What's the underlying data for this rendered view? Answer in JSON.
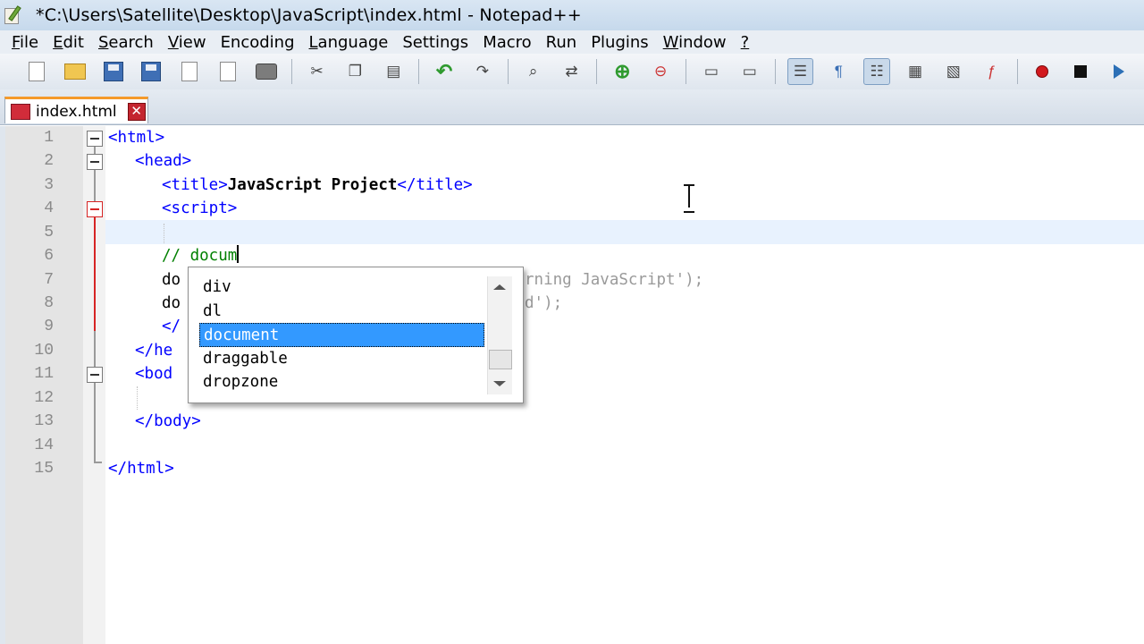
{
  "window": {
    "title": "*C:\\Users\\Satellite\\Desktop\\JavaScript\\index.html - Notepad++"
  },
  "menu": [
    {
      "ul": "F",
      "rest": "ile"
    },
    {
      "ul": "E",
      "rest": "dit"
    },
    {
      "ul": "S",
      "rest": "earch"
    },
    {
      "ul": "V",
      "rest": "iew"
    },
    {
      "ul": "",
      "rest": "Encoding"
    },
    {
      "ul": "L",
      "rest": "anguage"
    },
    {
      "ul": "",
      "rest": "Settings"
    },
    {
      "ul": "",
      "rest": "Macro"
    },
    {
      "ul": "",
      "rest": "Run"
    },
    {
      "ul": "",
      "rest": "Plugins"
    },
    {
      "ul": "W",
      "rest": "indow"
    },
    {
      "ul": "?",
      "rest": ""
    }
  ],
  "toolbar": {
    "icons": [
      "new-file-icon",
      "open-file-icon",
      "save-icon",
      "save-all-icon",
      "close-icon",
      "close-all-icon",
      "print-icon",
      "cut-icon",
      "copy-icon",
      "paste-icon",
      "undo-icon",
      "redo-icon",
      "find-icon",
      "replace-icon",
      "zoom-in-icon",
      "zoom-out-icon",
      "sync-vertical-icon",
      "sync-horizontal-icon",
      "word-wrap-icon",
      "show-all-chars-icon",
      "indent-guide-icon",
      "user-lang-icon",
      "doc-map-icon",
      "function-list-icon",
      "record-macro-icon",
      "stop-record-icon",
      "play-macro-icon"
    ]
  },
  "tab": {
    "label": "index.html",
    "close": "✕"
  },
  "editor": {
    "line_numbers": [
      "1",
      "2",
      "3",
      "4",
      "5",
      "6",
      "7",
      "8",
      "9",
      "10",
      "11",
      "12",
      "13",
      "14",
      "15"
    ],
    "lines": {
      "l1": "<html>",
      "l2": "<head>",
      "l3_open": "<title>",
      "l3_text": "JavaScript Project",
      "l3_close": "</title>",
      "l4": "<script>",
      "l6": "// docum",
      "l7_start": "do",
      "l7_end": "rning JavaScript');",
      "l8_start": "do",
      "l8_end": "d');",
      "l9": "</",
      "l10": "</he",
      "l11": "<bod",
      "l13": "</body>",
      "l15": "</html>"
    }
  },
  "autocomplete": {
    "items": [
      "div",
      "dl",
      "document",
      "draggable",
      "dropzone"
    ],
    "selected": "document"
  }
}
